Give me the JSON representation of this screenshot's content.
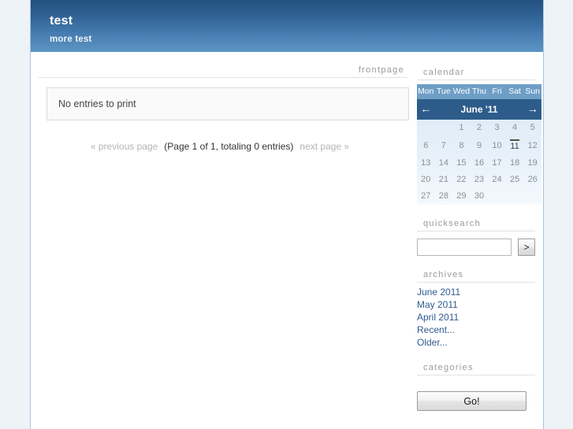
{
  "header": {
    "title": "test",
    "subtitle": "more test"
  },
  "content": {
    "section_label": "frontpage",
    "empty_message": "No entries to print",
    "pagination": {
      "previous": "« previous page",
      "info": "(Page 1 of 1, totaling 0 entries)",
      "next": "next page »"
    }
  },
  "sidebar": {
    "calendar": {
      "heading": "calendar",
      "prev_icon": "←",
      "next_icon": "→",
      "month_label": "June '11",
      "dow": [
        "Mon",
        "Tue",
        "Wed",
        "Thu",
        "Fri",
        "Sat",
        "Sun"
      ],
      "weeks": [
        [
          "",
          "",
          "1",
          "2",
          "3",
          "4",
          "5"
        ],
        [
          "6",
          "7",
          "8",
          "9",
          "10",
          "11",
          "12"
        ],
        [
          "13",
          "14",
          "15",
          "16",
          "17",
          "18",
          "19"
        ],
        [
          "20",
          "21",
          "22",
          "23",
          "24",
          "25",
          "26"
        ],
        [
          "27",
          "28",
          "29",
          "30",
          "",
          "",
          ""
        ]
      ],
      "today": "11",
      "title_bg": "#2d5c8b",
      "dow_bg": "#6e9ec6"
    },
    "quicksearch": {
      "heading": "quicksearch",
      "input_value": "",
      "input_placeholder": "",
      "submit_label": ">"
    },
    "archives": {
      "heading": "archives",
      "items": [
        {
          "label": "June 2011"
        },
        {
          "label": "May 2011"
        },
        {
          "label": "April 2011"
        },
        {
          "label": "Recent..."
        },
        {
          "label": "Older..."
        }
      ],
      "link_color": "#2f5b8f"
    },
    "categories": {
      "heading": "categories",
      "go_label": "Go!"
    }
  }
}
